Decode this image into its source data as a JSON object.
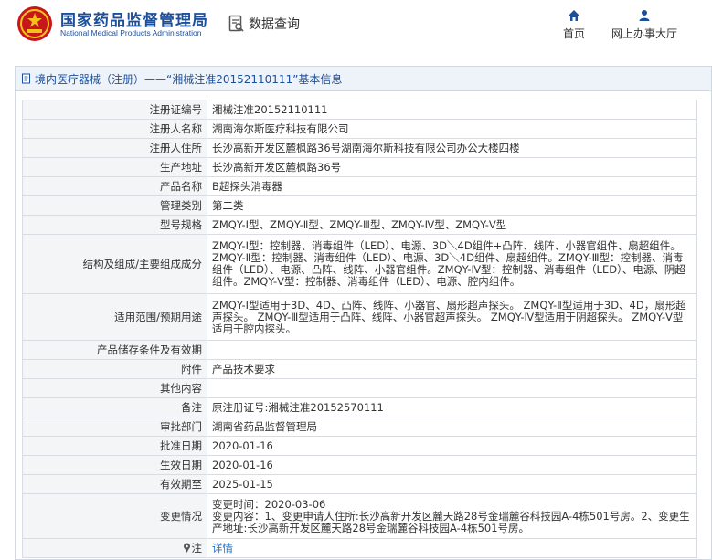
{
  "header": {
    "logo_cn": "国家药品监督管理局",
    "logo_en": "National Medical Products Administration",
    "search_label": "数据查询",
    "nav_home": "首页",
    "nav_hall": "网上办事大厅",
    "brand_color": "#1c4f99"
  },
  "panel": {
    "title": "境内医疗器械（注册）——“湘械注准20152110111”基本信息"
  },
  "rows": [
    {
      "label": "注册证编号",
      "value": "湘械注准20152110111"
    },
    {
      "label": "注册人名称",
      "value": "湖南海尔斯医疗科技有限公司"
    },
    {
      "label": "注册人住所",
      "value": "长沙高新开发区麓枫路36号湖南海尔斯科技有限公司办公大楼四楼"
    },
    {
      "label": "生产地址",
      "value": "长沙高新开发区麓枫路36号"
    },
    {
      "label": "产品名称",
      "value": "B超探头消毒器"
    },
    {
      "label": "管理类别",
      "value": "第二类"
    },
    {
      "label": "型号规格",
      "value": "ZMQY-Ⅰ型、ZMQY-Ⅱ型、ZMQY-Ⅲ型、ZMQY-Ⅳ型、ZMQY-Ⅴ型"
    },
    {
      "label": "结构及组成/主要组成成分",
      "value": "ZMQY-Ⅰ型：控制器、消毒组件（LED）、电源、3D＼4D组件+凸阵、线阵、小器官组件、扇超组件。ZMQY-Ⅱ型：控制器、消毒组件（LED）、电源、3D＼4D组件、扇超组件。ZMQY-Ⅲ型：控制器、消毒组件（LED）、电源、凸阵、线阵、小器官组件。ZMQY-Ⅳ型：控制器、消毒组件（LED）、电源、阴超组件。ZMQY-Ⅴ型：控制器、消毒组件（LED）、电源、腔内组件。"
    },
    {
      "label": "适用范围/预期用途",
      "value": "ZMQY-Ⅰ型适用于3D、4D、凸阵、线阵、小器官、扇形超声探头。 ZMQY-Ⅱ型适用于3D、4D，扇形超声探头。 ZMQY-Ⅲ型适用于凸阵、线阵、小器官超声探头。 ZMQY-Ⅳ型适用于阴超探头。 ZMQY-Ⅴ型适用于腔内探头。"
    },
    {
      "label": "产品储存条件及有效期",
      "value": ""
    },
    {
      "label": "附件",
      "value": "产品技术要求"
    },
    {
      "label": "其他内容",
      "value": ""
    },
    {
      "label": "备注",
      "value": "原注册证号:湘械注准20152570111"
    },
    {
      "label": "审批部门",
      "value": "湖南省药品监督管理局"
    },
    {
      "label": "批准日期",
      "value": "2020-01-16"
    },
    {
      "label": "生效日期",
      "value": "2020-01-16"
    },
    {
      "label": "有效期至",
      "value": "2025-01-15"
    },
    {
      "label": "变更情况",
      "value": "变更时间：2020-03-06\n变更内容：1、变更申请人住所:长沙高新开发区麓天路28号金瑞麓谷科技园A-4栋501号房。2、变更生产地址:长沙高新开发区麓天路28号金瑞麓谷科技园A-4栋501号房。"
    },
    {
      "label": "注",
      "value": "详情"
    }
  ]
}
